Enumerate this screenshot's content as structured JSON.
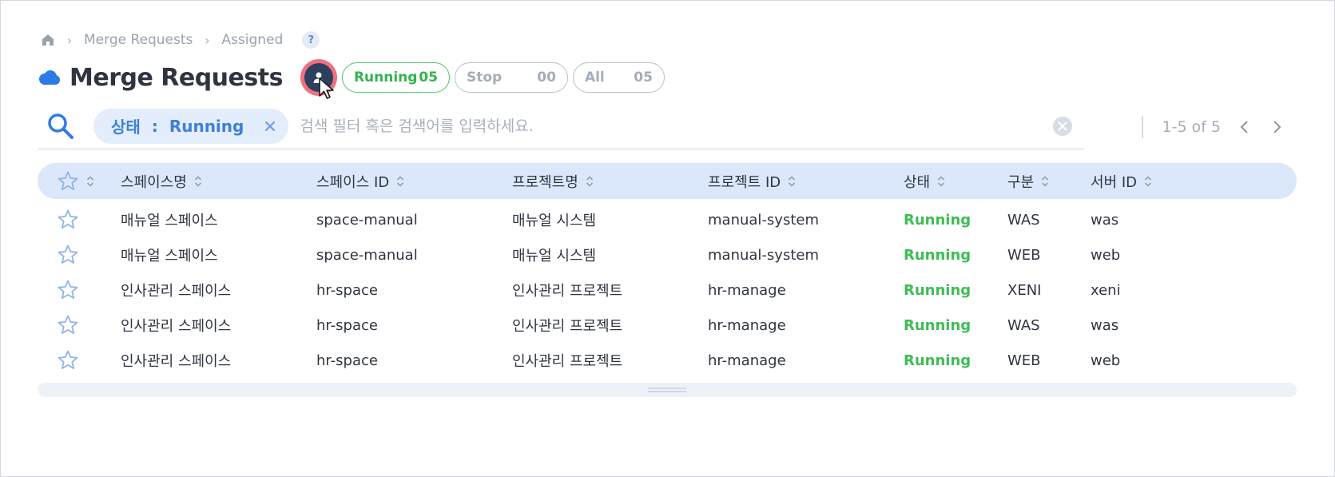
{
  "breadcrumb": {
    "items": [
      "Merge Requests",
      "Assigned"
    ],
    "help_label": "?"
  },
  "header": {
    "title": "Merge Requests",
    "filters": [
      {
        "label": "Running",
        "count": "05",
        "color": "#34b44f",
        "active": true
      },
      {
        "label": "Stop",
        "count": "00",
        "active": false
      },
      {
        "label": "All",
        "count": "05",
        "active": false
      }
    ]
  },
  "search": {
    "chip_key": "상태",
    "chip_sep": ":",
    "chip_value": "Running",
    "placeholder": "검색 필터 혹은 검색어를 입력하세요."
  },
  "pager": {
    "range": "1-5 of 5"
  },
  "table": {
    "columns": [
      "스페이스명",
      "스페이스 ID",
      "프로젝트명",
      "프로젝트 ID",
      "상태",
      "구분",
      "서버 ID"
    ],
    "rows": [
      {
        "space_name": "매뉴얼 스페이스",
        "space_id": "space-manual",
        "project_name": "매뉴얼 시스템",
        "project_id": "manual-system",
        "status": "Running",
        "type": "WAS",
        "server_id": "was"
      },
      {
        "space_name": "매뉴얼 스페이스",
        "space_id": "space-manual",
        "project_name": "매뉴얼 시스템",
        "project_id": "manual-system",
        "status": "Running",
        "type": "WEB",
        "server_id": "web"
      },
      {
        "space_name": "인사관리 스페이스",
        "space_id": "hr-space",
        "project_name": "인사관리 프로젝트",
        "project_id": "hr-manage",
        "status": "Running",
        "type": "XENI",
        "server_id": "xeni"
      },
      {
        "space_name": "인사관리 스페이스",
        "space_id": "hr-space",
        "project_name": "인사관리 프로젝트",
        "project_id": "hr-manage",
        "status": "Running",
        "type": "WAS",
        "server_id": "was"
      },
      {
        "space_name": "인사관리 스페이스",
        "space_id": "hr-space",
        "project_name": "인사관리 프로젝트",
        "project_id": "hr-manage",
        "status": "Running",
        "type": "WEB",
        "server_id": "web"
      }
    ]
  },
  "colors": {
    "accent": "#3f7fd8",
    "running": "#3fbd55",
    "header_bg": "#dbe8fb",
    "avatar_ring": "#f07080",
    "avatar_bg": "#2c3f5e"
  },
  "icons": {
    "home": "home-icon",
    "cloud": "cloud-icon",
    "user": "user-icon",
    "search": "search-icon",
    "clear": "clear-icon",
    "star": "star-icon",
    "sort": "sort-icon"
  }
}
